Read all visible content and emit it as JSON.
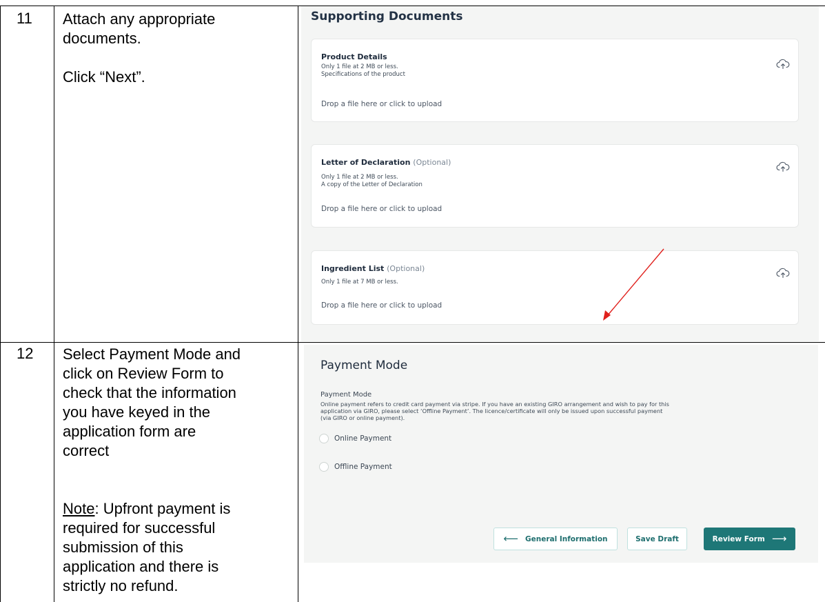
{
  "rows": [
    {
      "number": "11",
      "instruction_line1": "Attach any appropriate",
      "instruction_line2": "documents.",
      "instruction_line3": "Click “Next”."
    },
    {
      "number": "12",
      "instruction_lines": [
        "Select Payment Mode and",
        "click on Review Form to",
        "check that the information",
        "you have keyed in the",
        "application form are",
        "correct"
      ],
      "note_label": "Note",
      "note_rest_line1": ": Upfront payment is",
      "note_lines": [
        "required for successful",
        "submission of this",
        "application and there is",
        "strictly no refund."
      ]
    }
  ],
  "supporting_documents": {
    "title": "Supporting Documents",
    "cards": [
      {
        "title": "Product Details",
        "optional": "",
        "line1": "Only 1 file at 2 MB or less.",
        "line2": "Specifications of the product",
        "drop": "Drop a file here or click to upload",
        "icon": "cloud-upload-icon"
      },
      {
        "title": "Letter of Declaration",
        "optional": "(Optional)",
        "line1": "Only 1 file at 2 MB or less.",
        "line2": "A copy of the Letter of Declaration",
        "drop": "Drop a file here or click to upload",
        "icon": "cloud-upload-icon"
      },
      {
        "title": "Ingredient List",
        "optional": "(Optional)",
        "line1": "Only 1 file at 7 MB or less.",
        "line2": "",
        "drop": "Drop a file here or click to upload",
        "icon": "cloud-upload-icon"
      }
    ],
    "annotation_arrow_color": "#e0201c"
  },
  "payment_mode": {
    "title": "Payment Mode",
    "label": "Payment Mode",
    "note_line1": "Online payment refers to credit card payment via stripe. If you have an existing GIRO arrangement and wish to pay for this",
    "note_line2": "application via GIRO, please select ‘Offline Payment’. The licence/certificate will only be issued upon successful payment",
    "note_line3": "(via GIRO or online payment).",
    "options": [
      "Online Payment",
      "Offline Payment"
    ],
    "buttons": {
      "back": "General Information",
      "save": "Save Draft",
      "review": "Review Form"
    },
    "accent_color": "#1e7777"
  }
}
